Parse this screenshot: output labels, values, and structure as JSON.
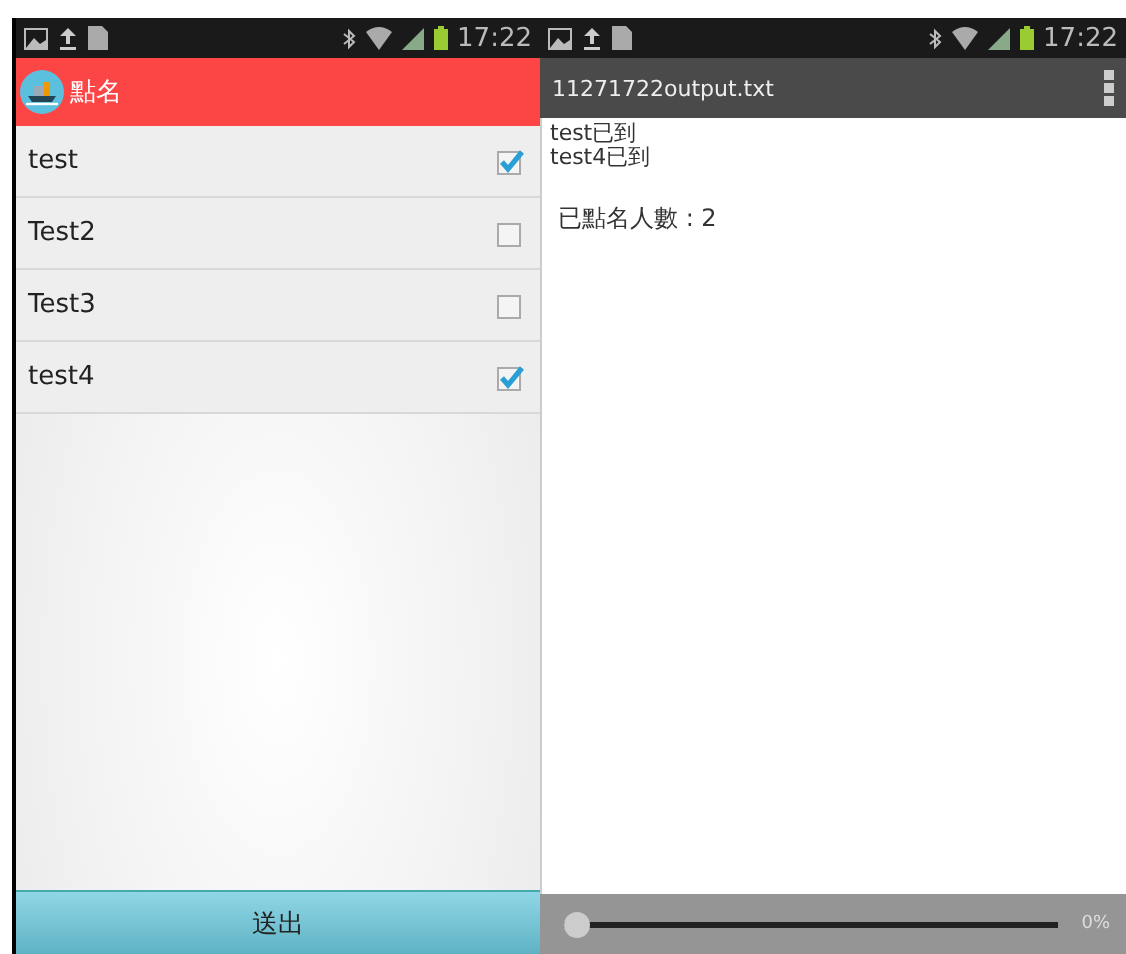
{
  "left": {
    "status_bar": {
      "time": "17:22"
    },
    "app_bar": {
      "title": "點名"
    },
    "items": [
      {
        "label": "test",
        "checked": true
      },
      {
        "label": "Test2",
        "checked": false
      },
      {
        "label": "Test3",
        "checked": false
      },
      {
        "label": "test4",
        "checked": true
      }
    ],
    "submit_button": "送出"
  },
  "right": {
    "status_bar": {
      "time": "17:22"
    },
    "app_bar": {
      "title": "11271722output.txt"
    },
    "lines": [
      "test已到",
      "test4已到"
    ],
    "summary": "已點名人數 : 2",
    "player": {
      "level": 0,
      "reading": "0%"
    }
  }
}
